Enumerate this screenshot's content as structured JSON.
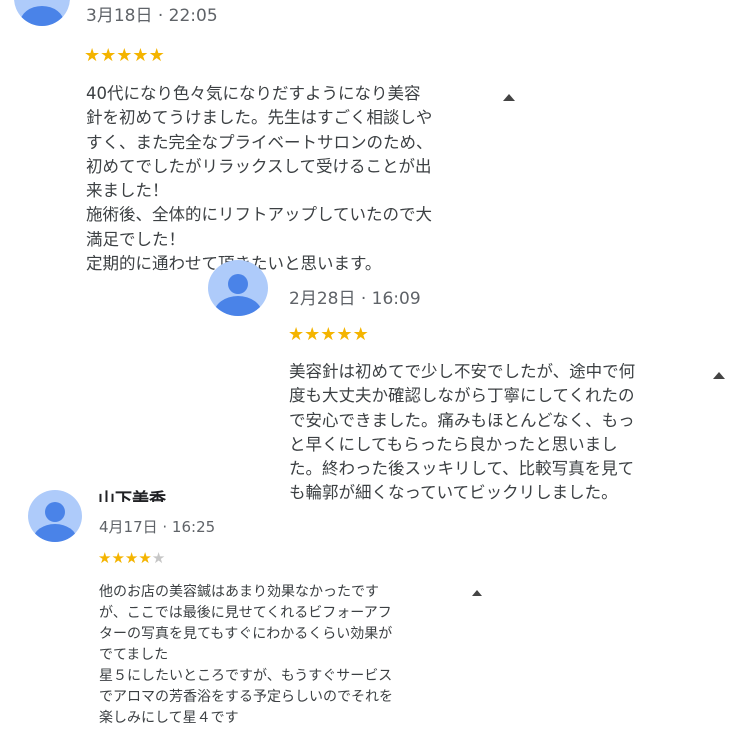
{
  "reviews": [
    {
      "date": "3月18日 · 22:05",
      "rating": 5,
      "text": "40代になり色々気になりだすようになり美容\n針を初めてうけました。先生はすごく相談しや\nすく、また完全なプライベートサロンのため、\n初めてでしたがリラックスして受けることが出\n来ました！\n施術後、全体的にリフトアップしていたので大\n満足でした！\n定期的に通わせて頂きたいと思います。"
    },
    {
      "date": "2月28日 · 16:09",
      "rating": 5,
      "text": "美容針は初めてで少し不安でしたが、途中で何\n度も大丈夫か確認しながら丁寧にしてくれたの\nで安心できました。痛みもほとんどなく、もっ\nと早くにしてもらったら良かったと思いまし\nた。終わった後スッキリして、比較写真を見て\nも輪郭が細くなっていてビックリしました。"
    },
    {
      "name": "山下美香",
      "date": "4月17日 · 16:25",
      "rating": 4,
      "text": "他のお店の美容鍼はあまり効果なかったです\nが、ここでは最後に見せてくれるビフォーアフ\nターの写真を見てもすぐにわかるくらい効果が\nでてました\n星５にしたいところですが、もうすぐサービス\nでアロマの芳香浴をする予定らしいのでそれを\n楽しみにして星４です"
    }
  ],
  "colors": {
    "star": "#f4b400",
    "star_empty": "#c6c6c6",
    "avatar_bg": "#aecbfa",
    "avatar_fg": "#4a83e8"
  },
  "icons": {
    "avatar": "person-avatar-icon",
    "collapse": "caret-up-icon"
  }
}
